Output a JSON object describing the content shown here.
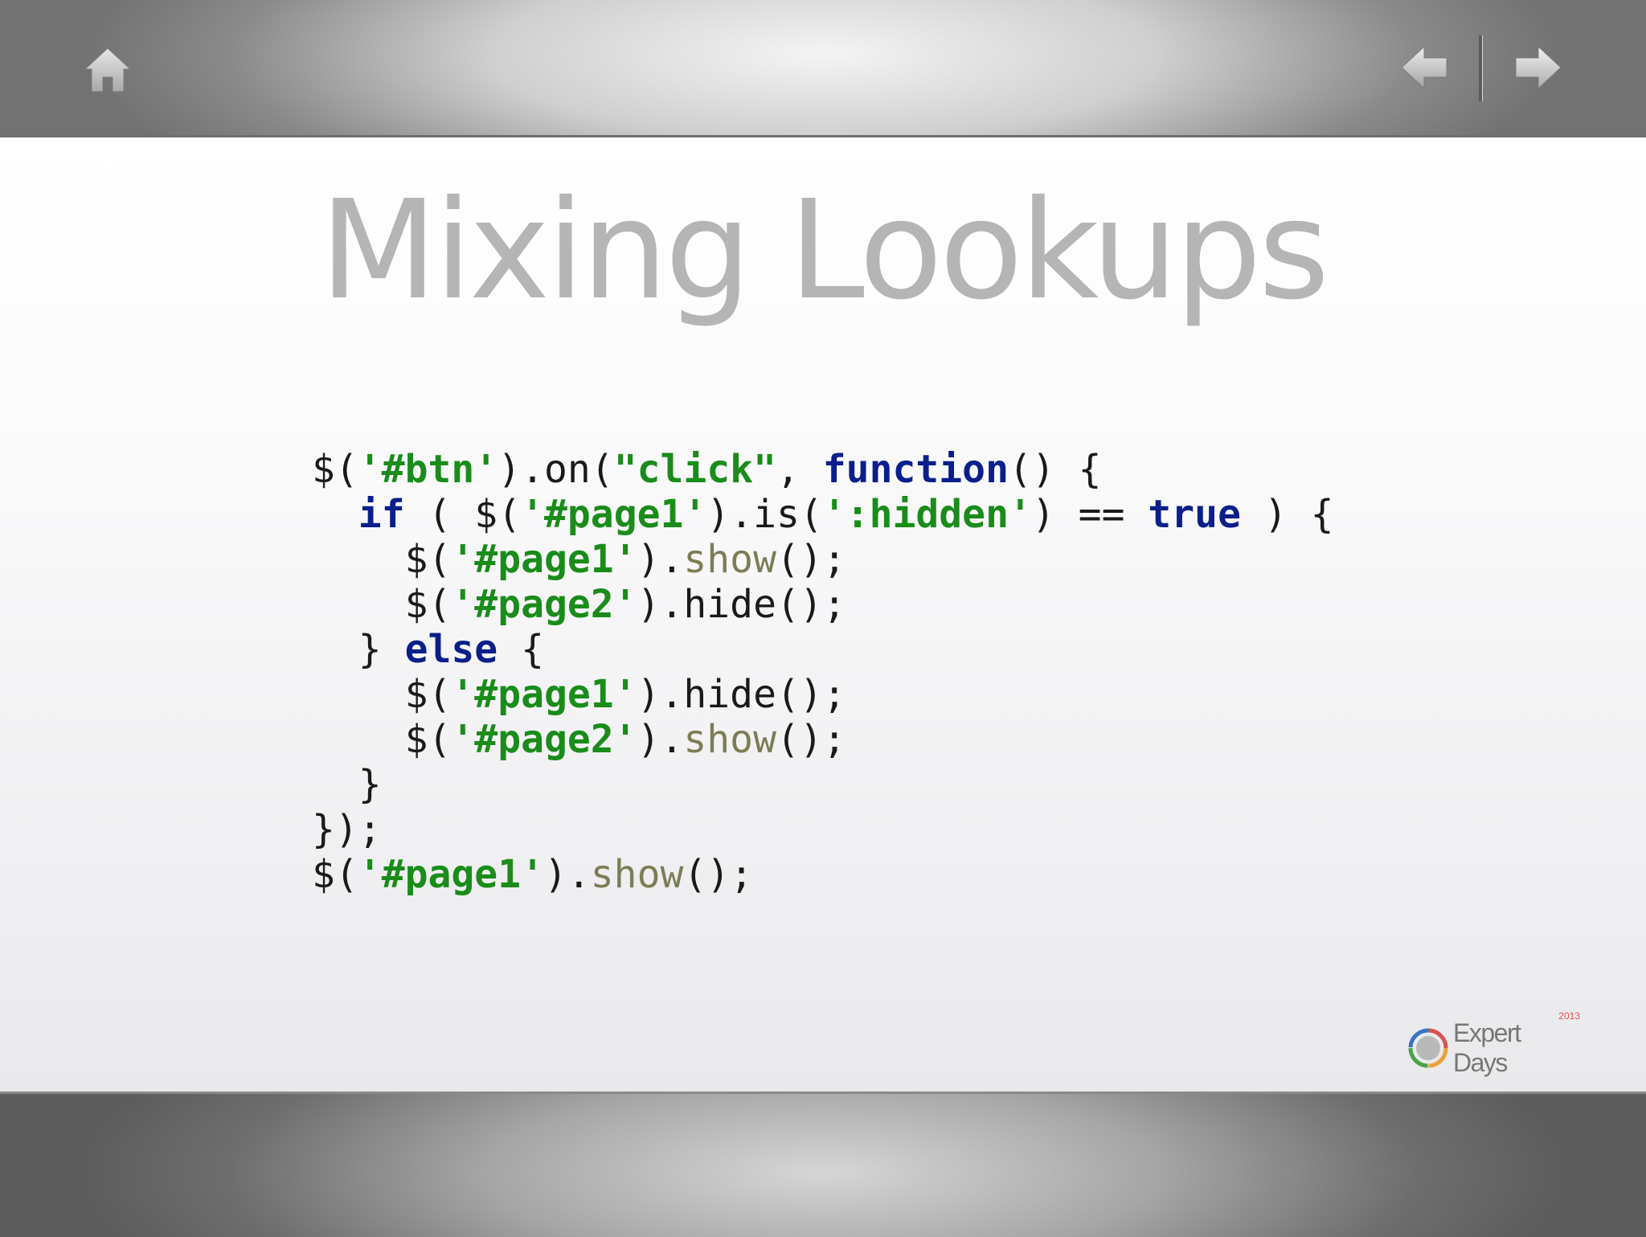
{
  "slide": {
    "title": "Mixing Lookups",
    "code_lines": [
      [
        {
          "t": "$(",
          "k": "plain"
        },
        {
          "t": "'#btn'",
          "k": "str"
        },
        {
          "t": ").on(",
          "k": "plain"
        },
        {
          "t": "\"click\"",
          "k": "str"
        },
        {
          "t": ", ",
          "k": "plain"
        },
        {
          "t": "function",
          "k": "kw"
        },
        {
          "t": "() {",
          "k": "plain"
        }
      ],
      [
        {
          "t": "  ",
          "k": "plain"
        },
        {
          "t": "if",
          "k": "kw"
        },
        {
          "t": " ( $(",
          "k": "plain"
        },
        {
          "t": "'#page1'",
          "k": "str"
        },
        {
          "t": ").is(",
          "k": "plain"
        },
        {
          "t": "':hidden'",
          "k": "str"
        },
        {
          "t": ") == ",
          "k": "plain"
        },
        {
          "t": "true",
          "k": "kw"
        },
        {
          "t": " ) {",
          "k": "plain"
        }
      ],
      [
        {
          "t": "    $(",
          "k": "plain"
        },
        {
          "t": "'#page1'",
          "k": "str"
        },
        {
          "t": ").",
          "k": "plain"
        },
        {
          "t": "show",
          "k": "fn"
        },
        {
          "t": "();",
          "k": "plain"
        }
      ],
      [
        {
          "t": "    $(",
          "k": "plain"
        },
        {
          "t": "'#page2'",
          "k": "str"
        },
        {
          "t": ").hide();",
          "k": "plain"
        }
      ],
      [
        {
          "t": "  } ",
          "k": "plain"
        },
        {
          "t": "else",
          "k": "kw"
        },
        {
          "t": " {",
          "k": "plain"
        }
      ],
      [
        {
          "t": "    $(",
          "k": "plain"
        },
        {
          "t": "'#page1'",
          "k": "str"
        },
        {
          "t": ").hide();",
          "k": "plain"
        }
      ],
      [
        {
          "t": "    $(",
          "k": "plain"
        },
        {
          "t": "'#page2'",
          "k": "str"
        },
        {
          "t": ").",
          "k": "plain"
        },
        {
          "t": "show",
          "k": "fn"
        },
        {
          "t": "();",
          "k": "plain"
        }
      ],
      [
        {
          "t": "  }",
          "k": "plain"
        }
      ],
      [
        {
          "t": "});",
          "k": "plain"
        }
      ],
      [
        {
          "t": "$(",
          "k": "plain"
        },
        {
          "t": "'#page1'",
          "k": "str"
        },
        {
          "t": ").",
          "k": "plain"
        },
        {
          "t": "show",
          "k": "fn"
        },
        {
          "t": "();",
          "k": "plain"
        }
      ]
    ]
  },
  "toolbar": {
    "home_icon": "home-icon",
    "back_icon": "arrow-left-icon",
    "forward_icon": "arrow-right-icon"
  },
  "branding": {
    "logo_text": "Expert Days",
    "logo_year": "2013"
  },
  "colors": {
    "string": "#1a8c1a",
    "keyword": "#0a1f8a",
    "method": "#7d7d55",
    "title": "#b5b5b5"
  }
}
